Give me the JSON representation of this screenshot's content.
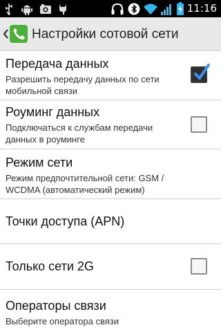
{
  "statusbar": {
    "time": "11:16",
    "left_icons": [
      "usb-icon",
      "android-debug-icon",
      "camera-icon",
      "cat-icon"
    ],
    "right_icons": [
      "headphones-icon",
      "bluetooth-icon",
      "wifi-icon",
      "signal-icon",
      "battery-charging-icon"
    ]
  },
  "actionbar": {
    "title": "Настройки сотовой сети"
  },
  "settings": [
    {
      "title": "Передача данных",
      "subtitle": "Разрешить передачу данных по сети мобильной связи",
      "checked": true
    },
    {
      "title": "Роуминг данных",
      "subtitle": "Подключаться к службам передачи данных в роуминге",
      "checked": false
    },
    {
      "title": "Режим сети",
      "subtitle": "Режим предпочтительной сети: GSM / WCDMA (автоматический режим)"
    },
    {
      "title": "Точки доступа (APN)"
    },
    {
      "title": "Только сети 2G",
      "checked": false
    },
    {
      "title": "Операторы связи",
      "subtitle": "Выберите оператора связи"
    }
  ],
  "colors": {
    "checkbox_checked": "#2e2e2e",
    "checkmark": "#3d8ff0",
    "actionbar_bg": "#e9e9e9",
    "phone_icon_bg": "#4caf3a"
  }
}
